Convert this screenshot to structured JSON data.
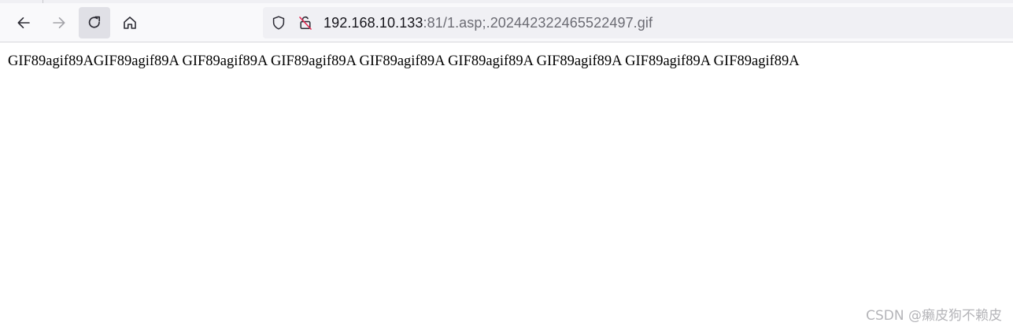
{
  "toolbar": {
    "buttons": {
      "back_icon": "arrow-left-icon",
      "forward_icon": "arrow-right-icon",
      "reload_icon": "reload-icon",
      "home_icon": "home-icon"
    },
    "url": {
      "host": "192.168.10.133",
      "rest": ":81/1.asp;.202442322465522497.gif",
      "site_info_icon": "shield-icon",
      "security_icon": "insecure-lock-icon"
    }
  },
  "page": {
    "body_text": "GIF89agif89AGIF89agif89A GIF89agif89A GIF89agif89A GIF89agif89A GIF89agif89A GIF89agif89A GIF89agif89A GIF89agif89A"
  },
  "watermark": {
    "text": "CSDN @癞皮狗不赖皮"
  },
  "colors": {
    "toolbar_bg": "#f9f9fb",
    "urlbar_bg": "#f0f0f4",
    "reload_active_bg": "#e0e0e6",
    "insecure_accent": "#e22850",
    "url_host": "#15141a",
    "url_muted": "#6b6b73"
  }
}
